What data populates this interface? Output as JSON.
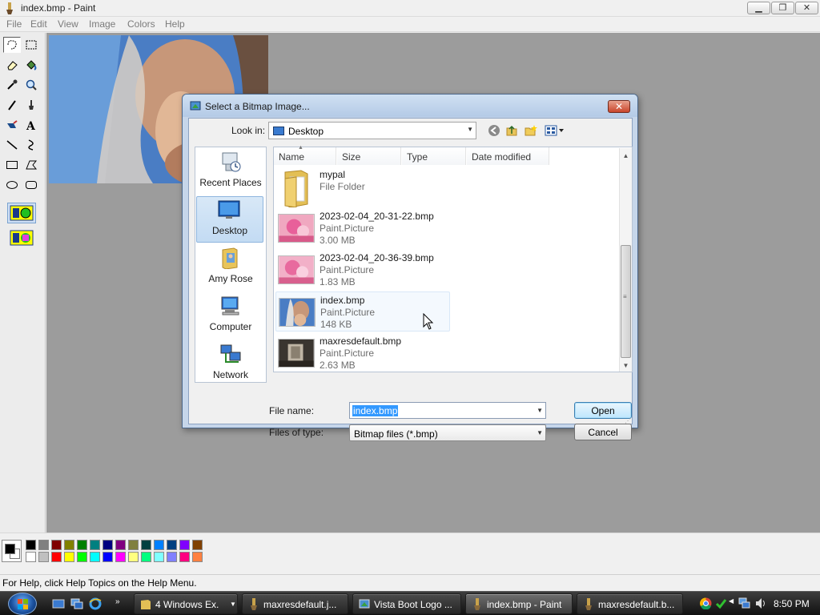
{
  "window": {
    "title": "index.bmp - Paint",
    "minimize_glyph": "▁",
    "maximize_glyph": "❐",
    "close_glyph": "✕"
  },
  "menu": [
    "File",
    "Edit",
    "View",
    "Image",
    "Colors",
    "Help"
  ],
  "toolbox_tools": [
    "free-form-select",
    "select",
    "eraser",
    "fill-with-color",
    "pick-color",
    "magnifier",
    "pencil",
    "brush",
    "airbrush",
    "text",
    "line",
    "curve",
    "rectangle",
    "polygon",
    "ellipse",
    "rounded-rectangle"
  ],
  "palette": {
    "foreground": "#000000",
    "background": "#ffffff",
    "row1": [
      "#000000",
      "#808080",
      "#800000",
      "#808000",
      "#008000",
      "#008080",
      "#000080",
      "#800080",
      "#808040",
      "#004040",
      "#0080ff",
      "#004080",
      "#8000ff",
      "#804000"
    ],
    "row2": [
      "#ffffff",
      "#c0c0c0",
      "#ff0000",
      "#ffff00",
      "#00ff00",
      "#00ffff",
      "#0000ff",
      "#ff00ff",
      "#ffff80",
      "#00ff80",
      "#80ffff",
      "#8080ff",
      "#ff0080",
      "#ff8040"
    ]
  },
  "statusbar": {
    "text": "For Help, click Help Topics on the Help Menu."
  },
  "dialog": {
    "title": "Select a Bitmap Image...",
    "close_glyph": "✕",
    "look_in_label": "Look in:",
    "look_in_value": "Desktop",
    "places": [
      {
        "label": "Recent Places",
        "icon": "recent-places-icon"
      },
      {
        "label": "Desktop",
        "icon": "desktop-icon",
        "selected": true
      },
      {
        "label": "Amy Rose",
        "icon": "user-folder-icon"
      },
      {
        "label": "Computer",
        "icon": "computer-icon"
      },
      {
        "label": "Network",
        "icon": "network-icon"
      }
    ],
    "columns": [
      "Name",
      "Size",
      "Type",
      "Date modified"
    ],
    "files": [
      {
        "name": "mypal",
        "type": "File Folder",
        "size": "",
        "thumb": "folder"
      },
      {
        "name": "2023-02-04_20-31-22.bmp",
        "type": "Paint.Picture",
        "size": "3.00 MB",
        "thumb": "pink"
      },
      {
        "name": "2023-02-04_20-36-39.bmp",
        "type": "Paint.Picture",
        "size": "1.83 MB",
        "thumb": "pink"
      },
      {
        "name": "index.bmp",
        "type": "Paint.Picture",
        "size": "148 KB",
        "thumb": "photo"
      },
      {
        "name": "maxresdefault.bmp",
        "type": "Paint.Picture",
        "size": "2.63 MB",
        "thumb": "dark"
      }
    ],
    "file_name_label": "File name:",
    "file_name_value": "index.bmp",
    "files_of_type_label": "Files of type:",
    "files_of_type_value": "Bitmap files (*.bmp)",
    "open_label": "Open",
    "cancel_label": "Cancel"
  },
  "taskbar": {
    "tasks": [
      "4 Windows Ex...",
      "maxresdefault.j...",
      "Vista Boot Logo ...",
      "index.bmp - Paint",
      "maxresdefault.b..."
    ],
    "clock": "8:50 PM"
  }
}
